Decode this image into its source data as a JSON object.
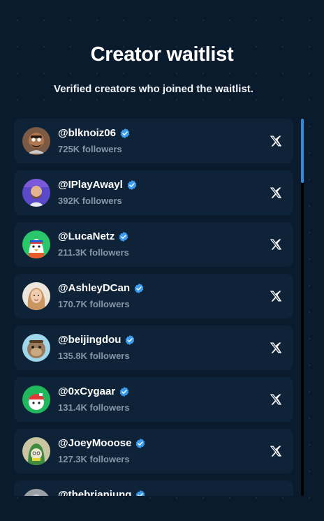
{
  "header": {
    "title": "Creator waitlist",
    "subtitle": "Verified creators who joined the waitlist."
  },
  "creators": [
    {
      "handle": "@blknoiz06",
      "followers": "725K followers",
      "avatar": "bearded-man-avatar",
      "avatar_bg": "#7d5a43"
    },
    {
      "handle": "@IPlayAwayl",
      "followers": "392K followers",
      "avatar": "purple-man-avatar",
      "avatar_bg": "#5a49c8"
    },
    {
      "handle": "@LucaNetz",
      "followers": "211.3K followers",
      "avatar": "penguin-avatar",
      "avatar_bg": "#29c76a"
    },
    {
      "handle": "@AshleyDCan",
      "followers": "170.7K followers",
      "avatar": "woman-avatar",
      "avatar_bg": "#c9a27a"
    },
    {
      "handle": "@beijingdou",
      "followers": "135.8K followers",
      "avatar": "ape-avatar",
      "avatar_bg": "#9ed6ec"
    },
    {
      "handle": "@0xCygaar",
      "followers": "131.4K followers",
      "avatar": "red-cap-avatar",
      "avatar_bg": "#1fb85c"
    },
    {
      "handle": "@JoeyMooose",
      "followers": "127.3K followers",
      "avatar": "green-hood-avatar",
      "avatar_bg": "#c9c4a2"
    },
    {
      "handle": "@thebrianjung",
      "followers": "",
      "avatar": "gray-avatar",
      "avatar_bg": "#9aa0a6"
    }
  ],
  "icons": {
    "verified": "verified-badge-icon",
    "link": "x-logo-icon"
  },
  "colors": {
    "background": "#0b1b2e",
    "card": "#0f2338",
    "verified": "#3a9bf0",
    "followers_text": "#8796a8",
    "scroll_thumb": "#2f8bd9"
  }
}
